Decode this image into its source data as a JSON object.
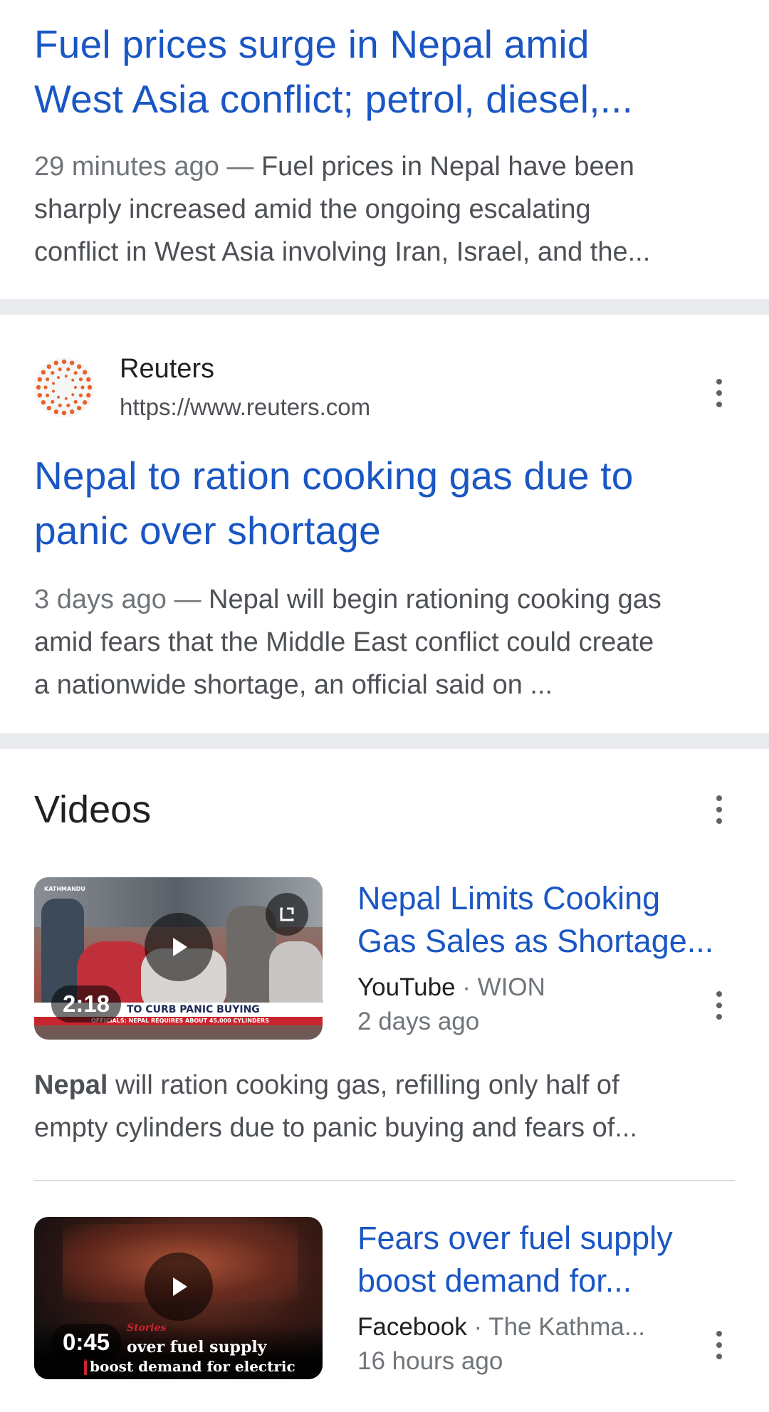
{
  "results": [
    {
      "title_line1": "Fuel prices surge in Nepal amid",
      "title_line2": "West Asia conflict; petrol, diesel,...",
      "time": "29 minutes ago",
      "separator": " — ",
      "snippet_first": "Fuel prices in Nepal have been",
      "snippet_line2": "sharply increased amid the ongoing escalating",
      "snippet_line3": "conflict in West Asia involving Iran, Israel, and the..."
    },
    {
      "site_name": "Reuters",
      "site_url": "https://www.reuters.com",
      "title_line1": "Nepal to ration cooking gas due to",
      "title_line2": "panic over shortage",
      "time": "3 days ago",
      "separator": " — ",
      "snippet_first": "Nepal will begin rationing cooking gas",
      "snippet_line2": "amid fears that the Middle East conflict could create",
      "snippet_line3": "a nationwide shortage, an official said on ..."
    }
  ],
  "videos_section": {
    "heading": "Videos",
    "items": [
      {
        "title_line1": "Nepal Limits Cooking",
        "title_line2": "Gas Sales as Shortage...",
        "platform": "YouTube",
        "dot": " · ",
        "channel": "WION",
        "date": "2 days ago",
        "duration": "2:18",
        "thumb_banner": "TO CURB PANIC BUYING",
        "thumb_subbanner": "OFFICIALS: NEPAL REQUIRES ABOUT 45,000 CYLINDERS",
        "thumb_corner": "KATHMANDU",
        "desc_bold": "Nepal",
        "desc_rest": " will ration cooking gas, refilling only half of",
        "desc_line2": "empty cylinders due to panic buying and fears of..."
      },
      {
        "title_line1": "Fears over fuel supply",
        "title_line2": "boost demand for...",
        "platform": "Facebook",
        "dot": " · ",
        "channel": "The Kathma...",
        "date": "16 hours ago",
        "duration": "0:45",
        "thumb_tag": "Stories",
        "thumb_line1": "over fuel supply",
        "thumb_line2": "boost demand for electric"
      }
    ]
  },
  "colors": {
    "link_blue": "#1a56c4",
    "snippet_gray": "#4d5156",
    "band_gray": "#e8eaed",
    "reuters_orange": "#e8622a"
  },
  "icons": {
    "more": "kebab-menu-icon",
    "play": "play-icon",
    "expand": "expand-icon",
    "logo": "reuters-logo-icon"
  }
}
